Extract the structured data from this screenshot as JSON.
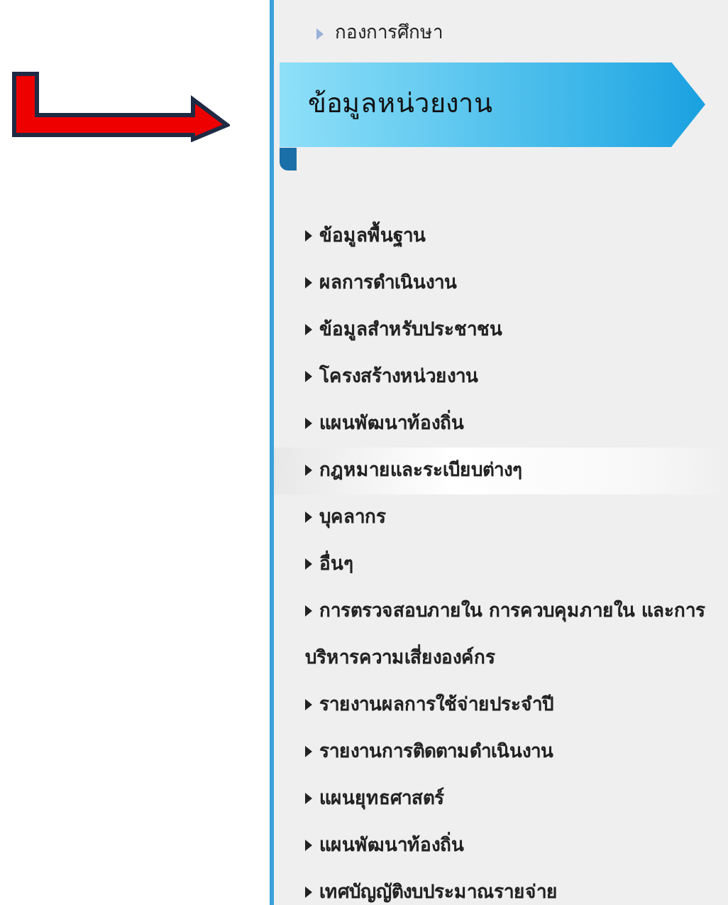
{
  "top_link": {
    "label": "กองการศึกษา"
  },
  "banner": {
    "title": "ข้อมูลหน่วยงาน"
  },
  "menu": [
    {
      "label": "ข้อมูลพื้นฐาน",
      "highlighted": false
    },
    {
      "label": "ผลการดำเนินงาน",
      "highlighted": false
    },
    {
      "label": "ข้อมูลสำหรับประชาชน",
      "highlighted": false
    },
    {
      "label": "โครงสร้างหน่วยงาน",
      "highlighted": false
    },
    {
      "label": "แผนพัฒนาท้องถิ่น",
      "highlighted": false
    },
    {
      "label": "กฎหมายและระเบียบต่างๆ",
      "highlighted": true
    },
    {
      "label": "บุคลากร",
      "highlighted": false
    },
    {
      "label": "อื่นๆ",
      "highlighted": false
    },
    {
      "label": "การตรวจสอบภายใน การควบคุมภายใน และการบริหารความเสี่ยงองค์กร",
      "highlighted": false
    },
    {
      "label": "รายงานผลการใช้จ่ายประจำปี",
      "highlighted": false
    },
    {
      "label": "รายงานการติดตามดำเนินงาน",
      "highlighted": false
    },
    {
      "label": "แผนยุทธศาสตร์",
      "highlighted": false
    },
    {
      "label": "แผนพัฒนาท้องถิ่น",
      "highlighted": false
    },
    {
      "label": "เทศบัญญัติงบประมาณรายจ่าย",
      "highlighted": false
    }
  ]
}
